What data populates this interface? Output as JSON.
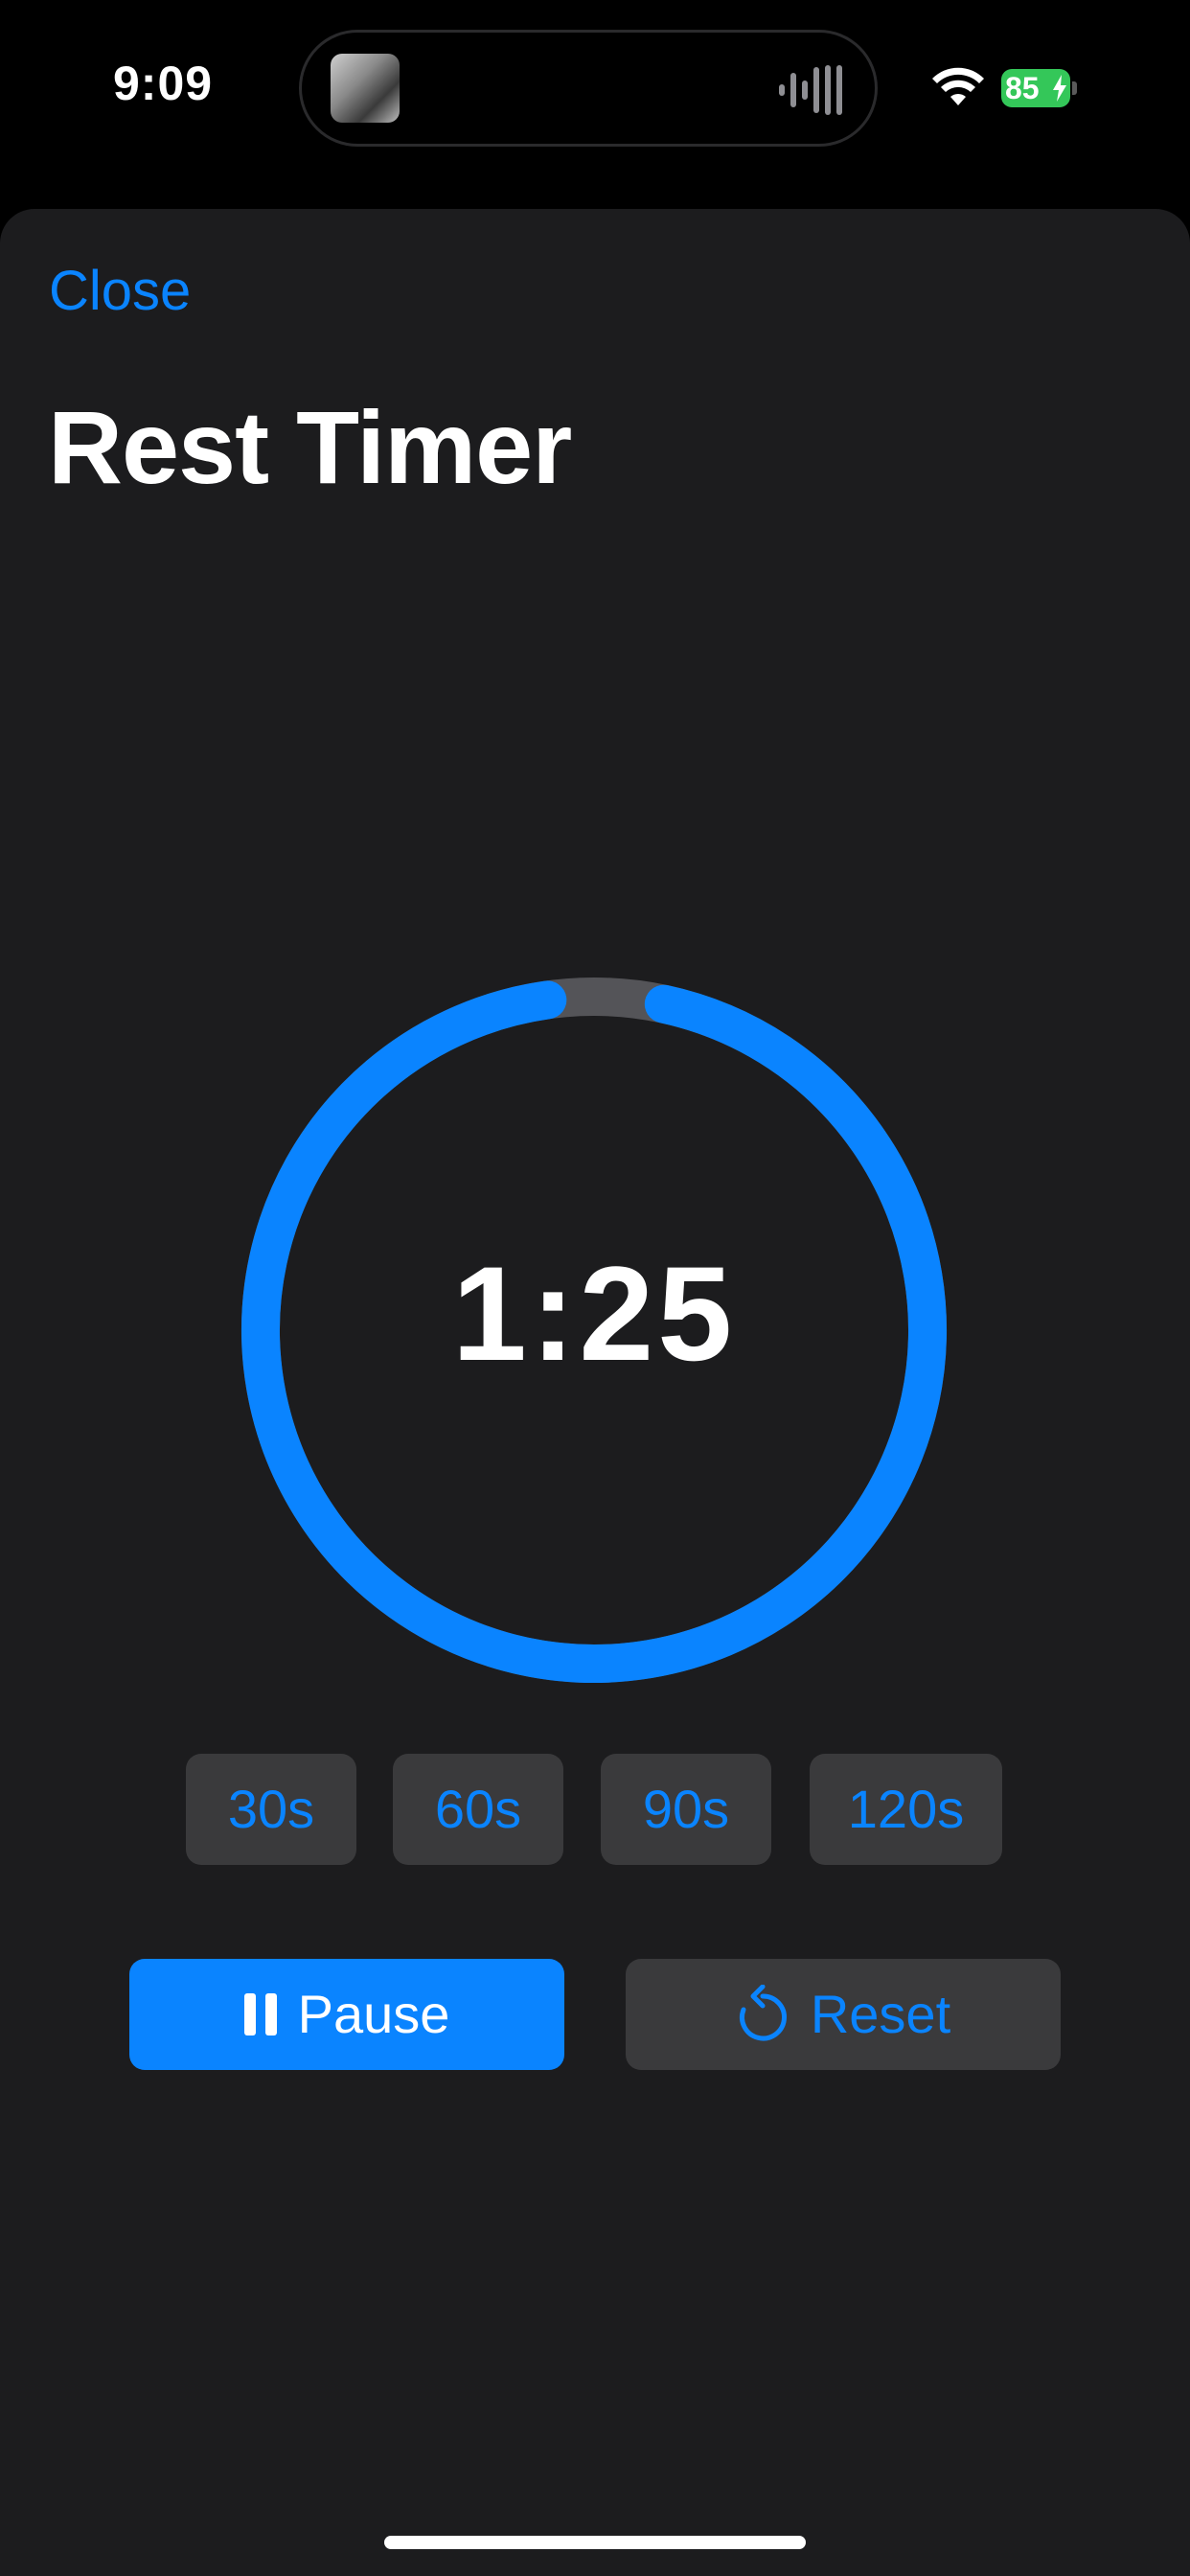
{
  "status_bar": {
    "time": "9:09",
    "battery_level": "85",
    "charging": true,
    "wifi": true
  },
  "header": {
    "close_label": "Close",
    "title": "Rest Timer"
  },
  "timer": {
    "remaining": "1:25",
    "progress_fraction": 0.944,
    "ring_color": "#0a84ff",
    "track_color": "#545458"
  },
  "presets": [
    "30s",
    "60s",
    "90s",
    "120s"
  ],
  "actions": {
    "pause_label": "Pause",
    "pause_icon": "pause-icon",
    "reset_label": "Reset",
    "reset_icon": "reset-arrow-icon"
  },
  "colors": {
    "accent": "#0a84ff",
    "sheet_background": "#1c1c1e",
    "button_background": "#3a3a3c",
    "battery": "#34c759"
  }
}
